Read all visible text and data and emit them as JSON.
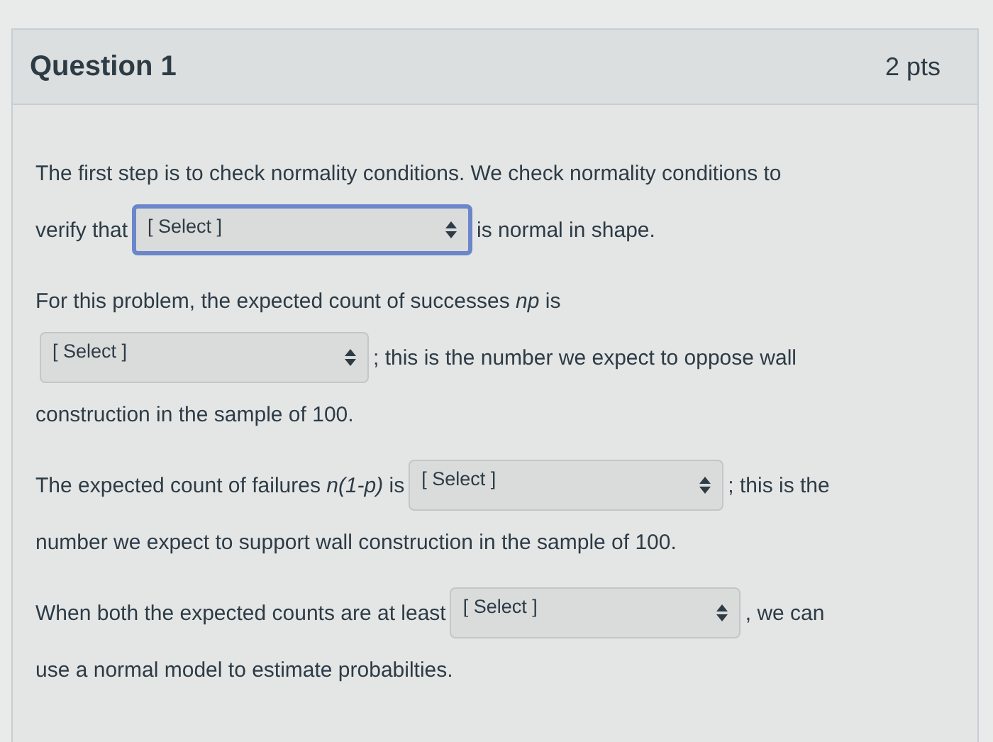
{
  "question": {
    "title": "Question 1",
    "points": "2 pts"
  },
  "paragraphs": [
    {
      "lines": [
        [
          {
            "kind": "text",
            "text": "The first step is to check normality conditions. We check normality conditions to"
          }
        ],
        [
          {
            "kind": "text",
            "text": "verify that"
          },
          {
            "kind": "select",
            "value": "[ Select ]",
            "focused": true
          },
          {
            "kind": "text",
            "text": "is normal in shape."
          }
        ]
      ]
    },
    {
      "lines": [
        [
          {
            "kind": "text",
            "text": "For this problem, the expected count of successes *np* is"
          }
        ],
        [
          {
            "kind": "select",
            "value": "[ Select ]",
            "focused": false
          },
          {
            "kind": "text",
            "text": "; this is the number we expect to oppose wall"
          }
        ],
        [
          {
            "kind": "text",
            "text": "construction in the sample of 100."
          }
        ]
      ]
    },
    {
      "lines": [
        [
          {
            "kind": "text",
            "text": "The expected count of failures *n(1-p)* is"
          },
          {
            "kind": "select",
            "value": "[ Select ]",
            "focused": false
          },
          {
            "kind": "text",
            "text": "; this is the"
          }
        ],
        [
          {
            "kind": "text",
            "text": "number we expect to support wall construction in the sample of 100."
          }
        ]
      ]
    },
    {
      "lines": [
        [
          {
            "kind": "text",
            "text": "When both the expected counts are at least"
          },
          {
            "kind": "select",
            "value": "[ Select ]",
            "focused": false
          },
          {
            "kind": "text",
            "text": ", we can"
          }
        ],
        [
          {
            "kind": "text",
            "text": "use a normal model to estimate probabilties."
          }
        ]
      ]
    }
  ]
}
